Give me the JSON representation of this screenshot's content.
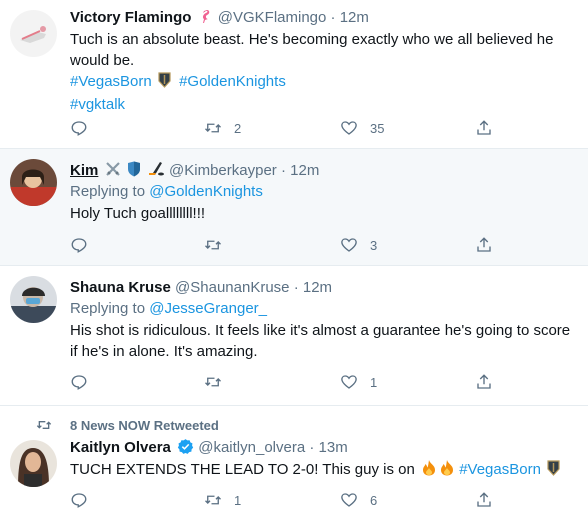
{
  "tweets": [
    {
      "name": "Victory Flamingo",
      "handle": "@VGKFlamingo",
      "time": "12m",
      "text_main": "Tuch is an absolute beast. He's becoming exactly who we all believed he would be.",
      "tags": [
        "#VegasBorn",
        "#GoldenKnights",
        "#vgktalk"
      ],
      "reply_count": "",
      "retweet_count": "2",
      "like_count": "35"
    },
    {
      "name": "Kim",
      "handle": "@Kimberkayper",
      "time": "12m",
      "replying_label": "Replying to",
      "replying_to": "@GoldenKnights",
      "text_main": "Holy Tuch goallllllll!!!",
      "retweet_count": "",
      "like_count": "3"
    },
    {
      "name": "Shauna Kruse",
      "handle": "@ShaunanKruse",
      "time": "12m",
      "replying_label": "Replying to",
      "replying_to": "@JesseGranger_",
      "text_main": "His shot is ridiculous. It feels like it's almost a guarantee he's going to score if he's in alone. It's amazing.",
      "retweet_count": "",
      "like_count": "1"
    },
    {
      "retweeted_by": "8 News NOW Retweeted",
      "name": "Kaitlyn Olvera",
      "handle": "@kaitlyn_olvera",
      "time": "13m",
      "text_main": "TUCH EXTENDS THE LEAD TO 2-0! This guy is on",
      "tags": [
        "#VegasBorn"
      ],
      "retweet_count": "1",
      "like_count": "6"
    }
  ],
  "separator": "·",
  "colors": {
    "link": "#1b95e0",
    "secondary": "#5b7083",
    "highlight_bg": "#f5f8fa",
    "border": "#e6ecf0"
  },
  "icons": [
    "reply-icon",
    "retweet-icon",
    "like-icon",
    "share-icon",
    "verified-badge-icon",
    "flamingo-emoji-icon",
    "golden-knights-logo-icon",
    "swords-emoji-icon",
    "shield-emoji-icon",
    "hockey-emoji-icon",
    "fire-emoji-icon"
  ]
}
